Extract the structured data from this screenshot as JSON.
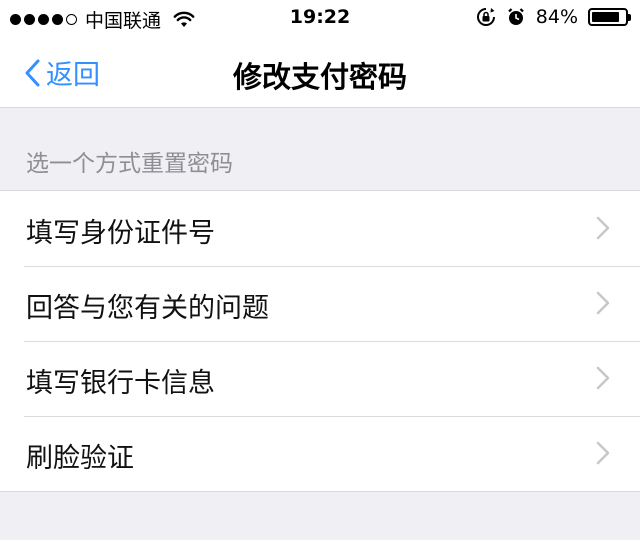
{
  "status_bar": {
    "carrier": "中国联通",
    "time": "19:22",
    "battery_percent": "84%",
    "battery_level": 0.84,
    "icons": [
      "signal-dots-icon",
      "wifi-icon",
      "rotation-lock-icon",
      "alarm-icon",
      "battery-icon"
    ]
  },
  "nav": {
    "back_label": "返回",
    "title": "修改支付密码"
  },
  "section": {
    "header": "选一个方式重置密码"
  },
  "options": [
    {
      "label": "填写身份证件号"
    },
    {
      "label": "回答与您有关的问题"
    },
    {
      "label": "填写银行卡信息"
    },
    {
      "label": "刷脸验证"
    }
  ],
  "colors": {
    "accent": "#3390ff",
    "background": "#f0eff4",
    "secondary_text": "#8e8e93"
  }
}
